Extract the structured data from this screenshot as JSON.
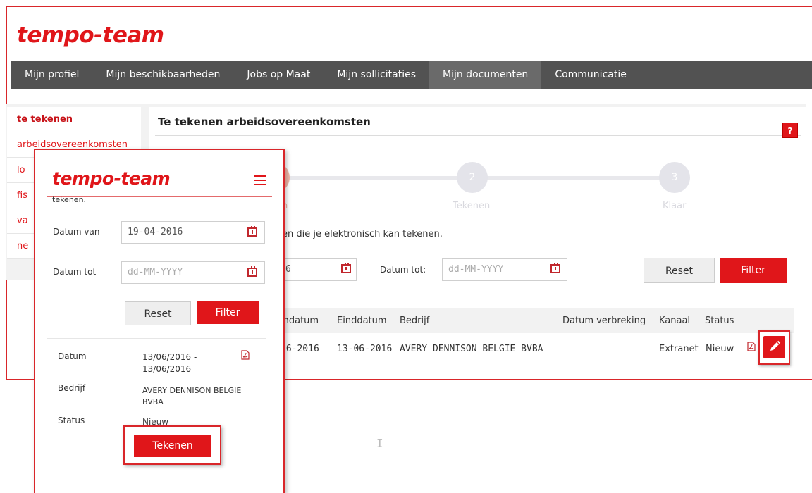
{
  "brand": {
    "logo_text": "tempo-team",
    "accent": "#e0161a"
  },
  "nav": {
    "items": [
      {
        "label": "Mijn profiel"
      },
      {
        "label": "Mijn beschikbaarheden"
      },
      {
        "label": "Jobs op Maat"
      },
      {
        "label": "Mijn sollicitaties"
      },
      {
        "label": "Mijn documenten",
        "active": true
      },
      {
        "label": "Communicatie"
      }
    ]
  },
  "sidebar": {
    "items": [
      {
        "label": "te tekenen",
        "active": true
      },
      {
        "label": "arbeidsovereenkomsten"
      },
      {
        "label": "lo"
      },
      {
        "label": "fis"
      },
      {
        "label": "va"
      },
      {
        "label": "ne"
      }
    ]
  },
  "main": {
    "title": "Te tekenen arbeidsovereenkomsten",
    "help": "?",
    "steps": [
      {
        "number": "1",
        "label": "n"
      },
      {
        "number": "2",
        "label": "Tekenen"
      },
      {
        "number": "3",
        "label": "Klaar"
      }
    ],
    "description": "en die je elektronisch kan tekenen.",
    "filter": {
      "date_from_value": "6",
      "date_to_label": "Datum tot:",
      "date_to_placeholder": "dd-MM-YYYY",
      "reset_label": "Reset",
      "filter_label": "Filter"
    },
    "table": {
      "headers": [
        "indatum",
        "Einddatum",
        "Bedrijf",
        "Datum verbreking",
        "Kanaal",
        "Status"
      ],
      "rows": [
        {
          "startdatum": "06-2016",
          "einddatum": "13-06-2016",
          "bedrijf": "AVERY DENNISON BELGIE BVBA",
          "datum_verbreking": "",
          "kanaal": "Extranet",
          "status": "Nieuw"
        }
      ]
    }
  },
  "mobile": {
    "logo_text": "tempo-team",
    "intro_fragment": "tekenen.",
    "date_from_label": "Datum van",
    "date_from_value": "19-04-2016",
    "date_to_label": "Datum tot",
    "date_to_placeholder": "dd-MM-YYYY",
    "reset_label": "Reset",
    "filter_label": "Filter",
    "card": {
      "datum_label": "Datum",
      "datum_value": "13/06/2016 -",
      "datum_value2": "13/06/2016",
      "bedrijf_label": "Bedrijf",
      "bedrijf_value": "AVERY DENNISON BELGIE",
      "bedrijf_value2": "BVBA",
      "status_label": "Status",
      "status_value": "Nieuw",
      "sign_label": "Tekenen"
    }
  }
}
